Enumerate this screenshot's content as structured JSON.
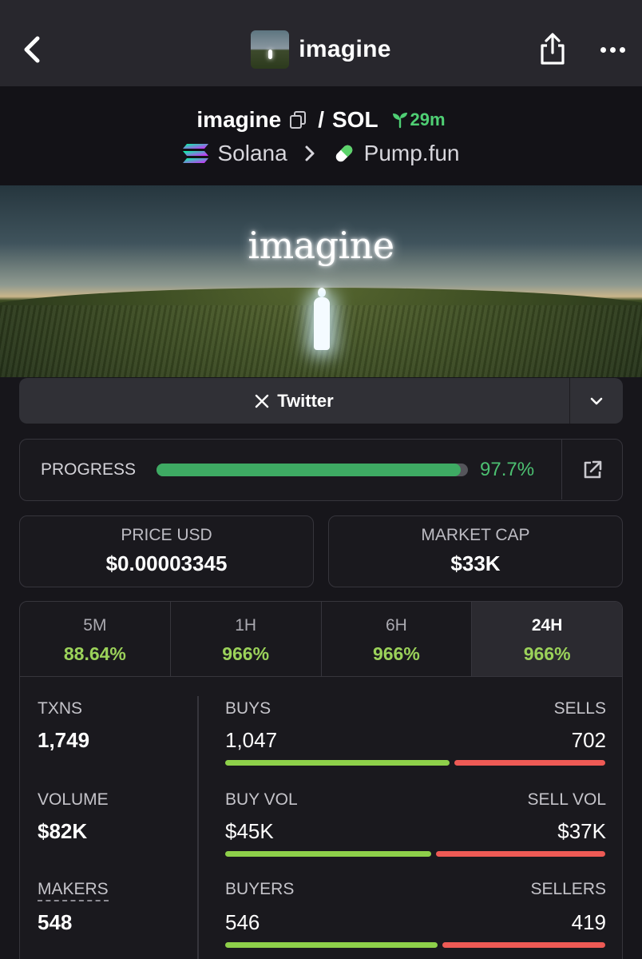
{
  "nav": {
    "title": "imagine",
    "icons": {
      "back": "chevron-left-icon",
      "share": "share-icon",
      "more": "more-dots-icon"
    }
  },
  "pair": {
    "base": "imagine",
    "separator": "/",
    "quote": "SOL",
    "age": "29m",
    "chain": "Solana",
    "dex": "Pump.fun"
  },
  "banner": {
    "title": "imagine"
  },
  "social": {
    "label": "Twitter",
    "icon": "x-logo-icon"
  },
  "progress": {
    "label": "PROGRESS",
    "percent": 97.7,
    "display": "97.7%"
  },
  "price": {
    "label": "PRICE USD",
    "value": "$0.00003345"
  },
  "market_cap": {
    "label": "MARKET CAP",
    "value": "$33K"
  },
  "timeframes": [
    {
      "label": "5M",
      "change": "88.64%",
      "active": false
    },
    {
      "label": "1H",
      "change": "966%",
      "active": false
    },
    {
      "label": "6H",
      "change": "966%",
      "active": false
    },
    {
      "label": "24H",
      "change": "966%",
      "active": true
    }
  ],
  "metrics": {
    "txns": {
      "label": "TXNS",
      "value": "1,749"
    },
    "volume": {
      "label": "VOLUME",
      "value": "$82K"
    },
    "makers": {
      "label": "MAKERS",
      "value": "548"
    },
    "buys": {
      "label": "BUYS",
      "value": "1,047",
      "count": 1047
    },
    "sells": {
      "label": "SELLS",
      "value": "702",
      "count": 702
    },
    "buy_vol": {
      "label": "BUY VOL",
      "value": "$45K",
      "amount": 45
    },
    "sell_vol": {
      "label": "SELL VOL",
      "value": "$37K",
      "amount": 37
    },
    "buyers": {
      "label": "BUYERS",
      "value": "546",
      "count": 546
    },
    "sellers": {
      "label": "SELLERS",
      "value": "419",
      "count": 419
    }
  },
  "colors": {
    "accent_green": "#4cc071",
    "change_green": "#9bd25a",
    "buy_bar": "#8ed04a",
    "sell_bar": "#ee5a55",
    "progress_fill": "#3eaa63"
  }
}
